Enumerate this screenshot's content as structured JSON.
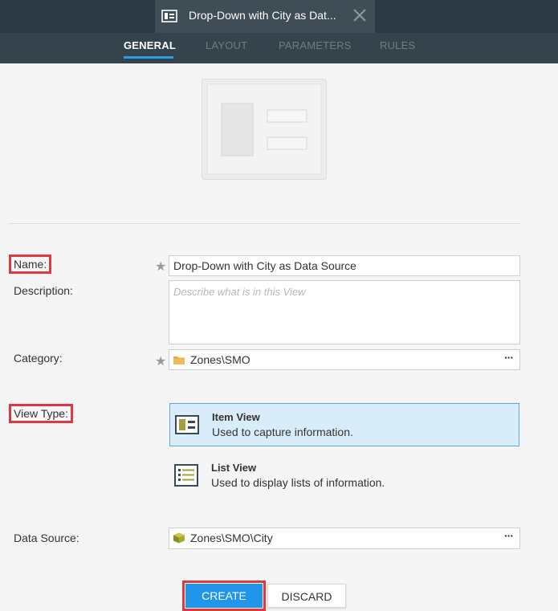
{
  "window": {
    "tab_title": "Drop-Down with City as Dat...",
    "tab_icon": "item-view-icon",
    "close_icon": "close-icon"
  },
  "nav": {
    "tabs": [
      {
        "label": "GENERAL",
        "active": true
      },
      {
        "label": "LAYOUT",
        "active": false
      },
      {
        "label": "PARAMETERS",
        "active": false
      },
      {
        "label": "RULES",
        "active": false
      }
    ]
  },
  "form": {
    "name_label": "Name:",
    "name_value": "Drop-Down with City as Data Source",
    "required_mark": "★",
    "description_label": "Description:",
    "description_placeholder": "Describe what is in this View",
    "category_label": "Category:",
    "category_value": "Zones\\SMO",
    "more_label": "···",
    "view_type_label": "View Type:",
    "view_types": [
      {
        "title": "Item View",
        "description": "Used to capture information.",
        "selected": true
      },
      {
        "title": "List View",
        "description": "Used to display lists of information.",
        "selected": false
      }
    ],
    "data_source_label": "Data Source:",
    "data_source_value": "Zones\\SMO\\City"
  },
  "buttons": {
    "create_label": "CREATE",
    "discard_label": "DISCARD"
  },
  "colors": {
    "accent": "#2196e8",
    "highlight": "#e0383e",
    "topbar": "#2b3942",
    "navbar": "#34434c",
    "selected_bg": "#d9ecf9"
  }
}
